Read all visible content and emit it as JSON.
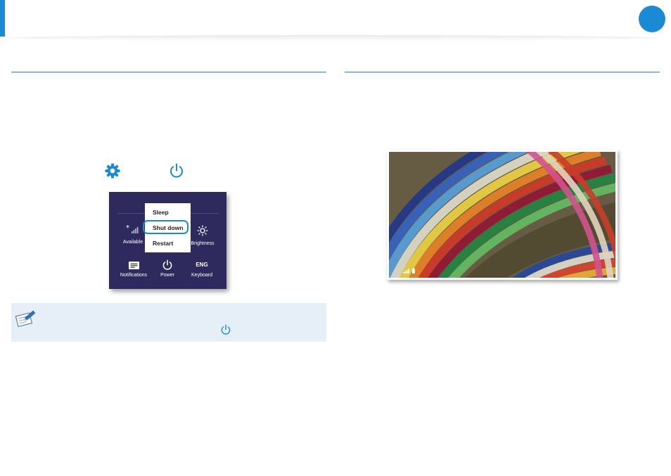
{
  "page": {
    "accent_color": "#1a8ad4",
    "note_background": "#e6eef8",
    "panel_background": "#2e2a5e"
  },
  "settings_panel": {
    "tiles": [
      {
        "label": "Available",
        "icon": "network-icon"
      },
      {
        "label": "Brightness",
        "icon": "brightness-icon"
      },
      {
        "label": "Notifications",
        "icon": "notifications-icon"
      },
      {
        "label": "Power",
        "icon": "power-icon"
      },
      {
        "label": "Keyboard",
        "icon": "keyboard-icon",
        "text": "ENG"
      }
    ],
    "power_menu": {
      "items": [
        "Sleep",
        "Shut down",
        "Restart"
      ],
      "highlighted": "Shut down"
    }
  },
  "icons": {
    "settings": "gear-icon",
    "power": "power-icon",
    "note": "memo-pencil-icon",
    "note_power": "power-icon"
  },
  "lock_screen": {
    "status_icons": [
      "signal-icon",
      "battery-icon"
    ]
  }
}
